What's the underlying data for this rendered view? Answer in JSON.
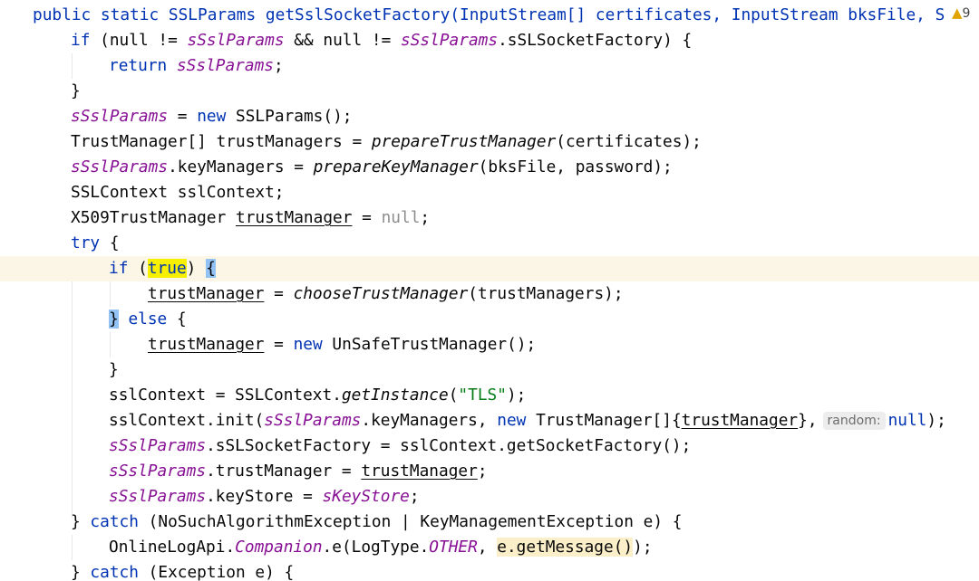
{
  "editor": {
    "warning_count": "9",
    "lines": {
      "l1_sig": "public static SSLParams getSslSocketFactory(InputStream[] certificates, InputStream bksFile, S",
      "l2_if": "if",
      "l2_a": " (null != ",
      "l2_f1": "sSslParams",
      "l2_b": " && null != ",
      "l2_f2": "sSslParams",
      "l2_c": ".sSLSocketFactory) {",
      "l3_ret": "return",
      "l3_sp": " ",
      "l3_f": "sSslParams",
      "l3_end": ";",
      "l4": "}",
      "l5_f": "sSslParams",
      "l5_a": " = ",
      "l5_new": "new",
      "l5_b": " SSLParams();",
      "l6_a": "TrustManager[] trustManagers = ",
      "l6_m": "prepareTrustManager",
      "l6_b": "(certificates);",
      "l7_f": "sSslParams",
      "l7_a": ".keyManagers = ",
      "l7_m": "prepareKeyManager",
      "l7_b": "(bksFile, password);",
      "l8": "SSLContext sslContext;",
      "l9_a": "X509TrustManager ",
      "l9_v": "trustManager",
      "l9_b": " = ",
      "l9_null": "null",
      "l9_end": ";",
      "l10_try": "try",
      "l10_b": " {",
      "l11_if": "if",
      "l11_a": " (",
      "l11_true": "true",
      "l11_b": ") ",
      "l11_brace": "{",
      "l12_v": "trustManager",
      "l12_a": " = ",
      "l12_m": "chooseTrustManager",
      "l12_b": "(trustManagers);",
      "l13_brace": "}",
      "l13_sp": " ",
      "l13_else": "else",
      "l13_b": " {",
      "l14_v": "trustManager",
      "l14_a": " = ",
      "l14_new": "new",
      "l14_b": " UnSafeTrustManager();",
      "l15": "}",
      "l16_a": "sslContext = SSLContext.",
      "l16_m": "getInstance",
      "l16_b": "(",
      "l16_str": "\"TLS\"",
      "l16_c": ");",
      "l17_a": "sslContext.init(",
      "l17_f": "sSslParams",
      "l17_b": ".keyManagers, ",
      "l17_new": "new",
      "l17_c": " TrustManager[]{",
      "l17_v": "trustManager",
      "l17_d": "},",
      "l17_hint": "random:",
      "l17_null": "null",
      "l17_end": ");",
      "l18_f": "sSslParams",
      "l18_a": ".sSLSocketFactory = sslContext.getSocketFactory();",
      "l19_f": "sSslParams",
      "l19_a": ".trustManager = ",
      "l19_v": "trustManager",
      "l19_end": ";",
      "l20_f": "sSslParams",
      "l20_a": ".keyStore = ",
      "l20_v": "sKeyStore",
      "l20_end": ";",
      "l21_a": "} ",
      "l21_catch": "catch",
      "l21_b": " (NoSuchAlgorithmException | KeyManagementException e) {",
      "l22_a": "OnlineLogApi.",
      "l22_c": "Companion",
      "l22_b": ".e(LogType.",
      "l22_k": "OTHER",
      "l22_d": ", ",
      "l22_e": "e.getMessage()",
      "l22_end": ");",
      "l23_a": "} ",
      "l23_catch": "catch",
      "l23_b": " (Exception e) {"
    }
  },
  "colors": {
    "keyword": "#0033b3",
    "field": "#871094",
    "string": "#067d17",
    "current_line": "#fcf6e6",
    "highlight_true": "#f7f000",
    "brace_match": "#93c3f5",
    "warning": "#e0a300"
  },
  "icons": {
    "warning": "warning-triangle-icon"
  }
}
